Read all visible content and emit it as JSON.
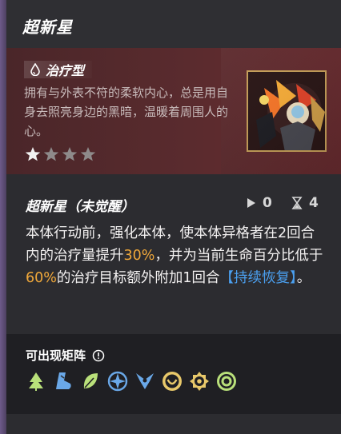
{
  "header": {
    "title": "超新星"
  },
  "hero": {
    "type_label": "治疗型",
    "description": "拥有与外表不符的柔软内心，总是用自身去照亮身边的黑暗，温暖着周围人的心。",
    "rating": {
      "filled": 1,
      "total": 4
    }
  },
  "skill": {
    "name": "超新星（未觉醒）",
    "play_count": "0",
    "hourglass_count": "4",
    "desc_part1": "本体行动前，强化本体，使本体异格者在2回合内的治疗量提升",
    "highlight1": "30%",
    "desc_part2": "，并为当前生命百分比低于",
    "highlight2": "60%",
    "desc_part3": "的治疗目标额外附加1回合",
    "keyword": "【持续恢复】",
    "desc_part4": "。"
  },
  "matrix": {
    "title": "可出现矩阵",
    "icons": [
      "tree-icon",
      "boot-icon",
      "leaf-icon",
      "compass-icon",
      "trident-icon",
      "smile-shield-icon",
      "gear-eye-icon",
      "target-ring-icon"
    ]
  },
  "colors": {
    "highlight": "#f0a83a",
    "keyword": "#4ba0f0",
    "accent_green": "#b9e07a"
  }
}
